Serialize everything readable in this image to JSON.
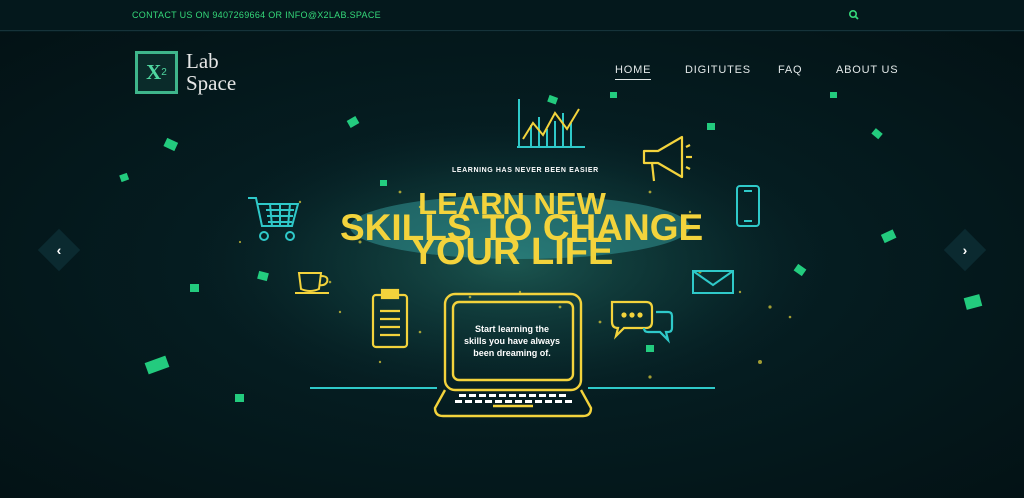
{
  "topbar": {
    "contact_text": "CONTACT US ON 9407269664 OR INFO@X2LAB.SPACE",
    "search_icon": "search-icon"
  },
  "logo": {
    "mark_letter": "X",
    "mark_subscript": "2",
    "line1": "Lab",
    "line2": "Space"
  },
  "nav": {
    "items": [
      {
        "label": "HOME",
        "active": true
      },
      {
        "label": "DIGITUTES",
        "active": false
      },
      {
        "label": "FAQ",
        "active": false
      },
      {
        "label": "ABOUT US",
        "active": false
      }
    ]
  },
  "hero": {
    "tagline": "LEARNING HAS NEVER BEEN EASIER",
    "headline_line1": "LEARN NEW",
    "headline_line2": "SKILLS TO CHANGE",
    "headline_line3": "YOUR LIFE",
    "laptop_text_line1": "Start learning the",
    "laptop_text_line2": "skills you have always",
    "laptop_text_line3": "been dreaming of.",
    "prev_icon": "chevron-left-icon",
    "next_icon": "chevron-right-icon",
    "prev_glyph": "‹",
    "next_glyph": "›"
  },
  "colors": {
    "accent_green": "#35d97a",
    "headline_yellow": "#f3d33c",
    "icon_cyan": "#2fc9c9",
    "background": "#041a1e"
  }
}
